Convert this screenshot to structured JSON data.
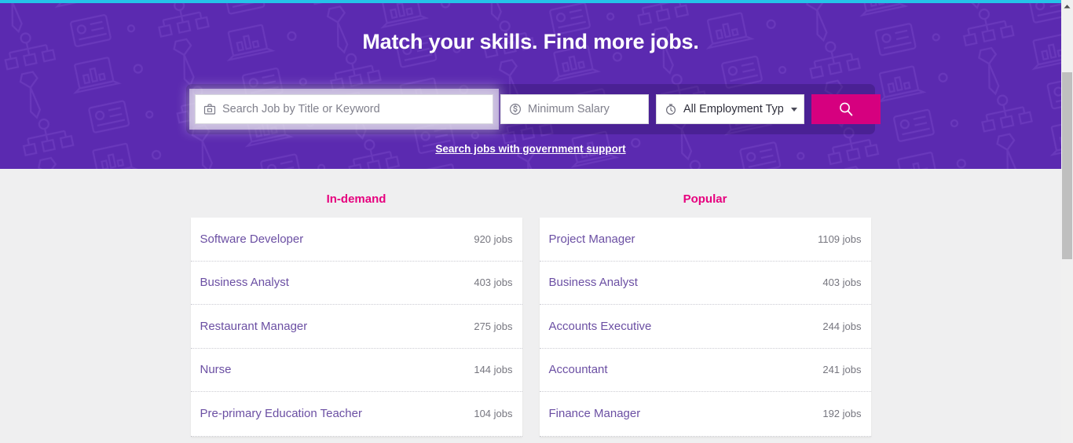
{
  "theme": {
    "hero_purple": "#5b2ab0",
    "accent_magenta": "#d6007f",
    "title_pink": "#e6007e",
    "link_purple": "#6b4fa3",
    "top_strip_cyan": "#24c3e8",
    "page_gray": "#efeff0"
  },
  "hero": {
    "title": "Match your skills. Find more jobs.",
    "gov_link": "Search jobs with government support"
  },
  "search": {
    "keyword_placeholder": "Search Job by Title or Keyword",
    "keyword_value": "",
    "salary_placeholder": "Minimum Salary",
    "salary_value": "",
    "employment_type_selected": "All Employment Types",
    "search_button_label": "Search",
    "icons": {
      "keyword": "briefcase-icon",
      "salary": "dollar-circle-icon",
      "type": "stopwatch-icon",
      "button": "search-icon"
    }
  },
  "columns": [
    {
      "key": "in_demand",
      "title": "In-demand",
      "items": [
        {
          "title": "Software Developer",
          "count": "920 jobs"
        },
        {
          "title": "Business Analyst",
          "count": "403 jobs"
        },
        {
          "title": "Restaurant Manager",
          "count": "275 jobs"
        },
        {
          "title": "Nurse",
          "count": "144 jobs"
        },
        {
          "title": "Pre-primary Education Teacher",
          "count": "104 jobs"
        }
      ]
    },
    {
      "key": "popular",
      "title": "Popular",
      "items": [
        {
          "title": "Project Manager",
          "count": "1109 jobs"
        },
        {
          "title": "Business Analyst",
          "count": "403 jobs"
        },
        {
          "title": "Accounts Executive",
          "count": "244 jobs"
        },
        {
          "title": "Accountant",
          "count": "241 jobs"
        },
        {
          "title": "Finance Manager",
          "count": "192 jobs"
        }
      ]
    }
  ],
  "scrollbar": {
    "up_arrow": "scroll-up-arrow-icon"
  }
}
